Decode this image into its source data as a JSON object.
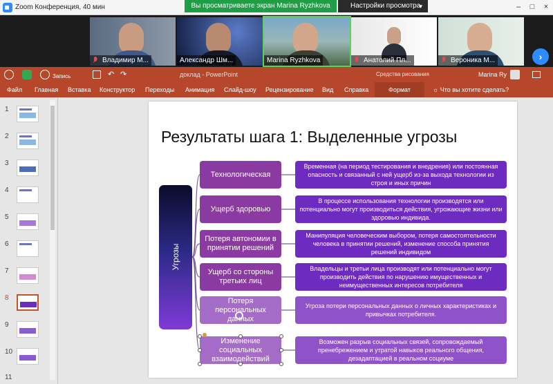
{
  "zoom": {
    "window_title": "Zoom Конференция, 40 мин",
    "share_banner": "Вы просматриваете экран Marina Ryzhkova",
    "view_options": "Настройки просмотра",
    "participants": [
      {
        "name": "Владимир М...",
        "muted": true
      },
      {
        "name": "Александр Шм...",
        "muted": false
      },
      {
        "name": "Marina Ryzhkova",
        "muted": false,
        "active_speaker": true
      },
      {
        "name": "Анатолий Пл...",
        "muted": true
      },
      {
        "name": "Вероника М...",
        "muted": true
      }
    ]
  },
  "ppt": {
    "record_label": "Запись",
    "doc_title": "доклад - PowerPoint",
    "drawing_tools": "Средства рисования",
    "user_name": "Marina Ry",
    "tabs": [
      "Файл",
      "Главная",
      "Вставка",
      "Конструктор",
      "Переходы",
      "Анимация",
      "Слайд-шоу",
      "Рецензирование",
      "Вид",
      "Справка"
    ],
    "format_tab": "Формат",
    "tell_me": "Что вы хотите сделать?",
    "thumbnail_numbers": [
      "1",
      "2",
      "3",
      "4",
      "5",
      "6",
      "7",
      "8",
      "9",
      "10",
      "11"
    ],
    "active_slide": 8
  },
  "slide": {
    "title": "Результаты шага 1: Выделенные угрозы",
    "root_label": "Угрозы",
    "threats": [
      {
        "label": "Технологическая",
        "description": "Временная (на период тестирования и внедрения) или постоянная опасность и связанный с ней ущерб из-за выхода технологии из строя и иных причин"
      },
      {
        "label": "Ущерб здоровью",
        "description": "В процессе использования технологии производятся или потенциально могут производиться действия, угрожающие жизни или здоровью индивида."
      },
      {
        "label": "Потеря автономии в принятии решений",
        "description": "Манипуляция человеческим выбором, потеря самостоятельности человека в принятии решений, изменение способа принятия решений индивидом"
      },
      {
        "label": "Ущерб со стороны третьих лиц",
        "description": "Владельцы и третьи лица производят или потенциально могут производить действия по нарушению имущественных и неимущественных интересов потребителя"
      },
      {
        "label": "Потеря персональных данных",
        "description": "Угроза потери персональных данных о личных характеристиках и привычках потребителя."
      },
      {
        "label": "Изменение социальных взаимодействий",
        "description": "Возможен разрыв социальных связей, сопровождаемый пренебрежением и утратой навыков реального общения, дезадаптацией в реальном социуме"
      }
    ]
  },
  "colors": {
    "ppt_brand": "#b7472a",
    "zoom_green": "#1f9e45",
    "zoom_blue": "#2d8cff",
    "threat_box": "#8a3aa0",
    "desc_box": "#6d2bc0"
  }
}
